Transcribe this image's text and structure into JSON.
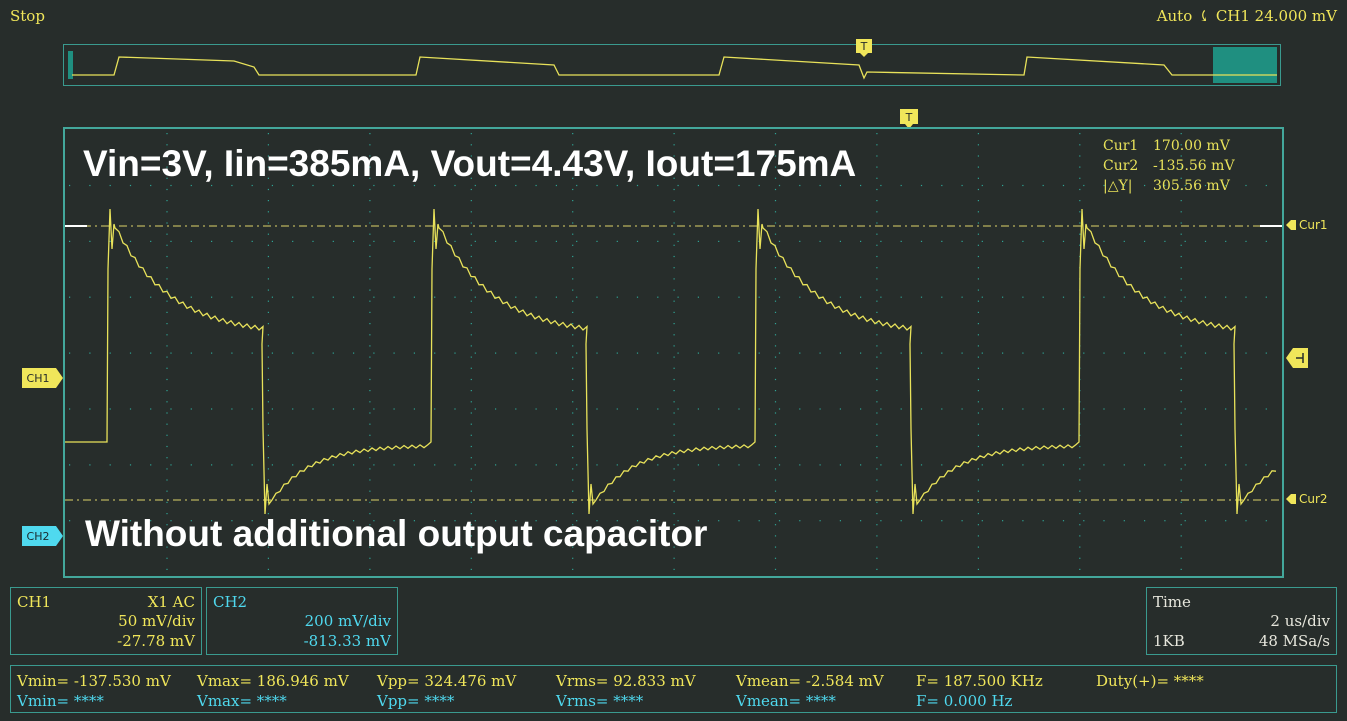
{
  "status": {
    "run_state": "Stop",
    "trigger_mode": "Auto",
    "trigger_source_level": "CH1  24.000 mV"
  },
  "overview": {
    "trigger_marker": "T"
  },
  "screen": {
    "trigger_marker": "T",
    "title_text": "Vin=3V, Iin=385mA, Vout=4.43V, Iout=175mA",
    "caption_text": "Without additional output capacitor",
    "ch1_marker": "CH1",
    "ch2_marker": "CH2",
    "cursor1_tag": "Cur1",
    "cursor2_tag": "Cur2",
    "cursor_readout": {
      "cur1_label": "Cur1",
      "cur1_value": "170.00 mV",
      "cur2_label": "Cur2",
      "cur2_value": "-135.56 mV",
      "delta_label": "|△Y|",
      "delta_value": "305.56 mV"
    }
  },
  "ch1_panel": {
    "name": "CH1",
    "probe_coupling": "X1  AC",
    "scale": "50 mV/div",
    "offset": "-27.78 mV"
  },
  "ch2_panel": {
    "name": "CH2",
    "scale": "200 mV/div",
    "offset": "-813.33 mV"
  },
  "time_panel": {
    "name": "Time",
    "scale": "2 us/div",
    "memory_depth": "1KB",
    "sample_rate": "48 MSa/s"
  },
  "measurements": {
    "ch1": [
      "Vmin= -137.530 mV",
      "Vmax= 186.946 mV",
      "Vpp= 324.476 mV",
      "Vrms= 92.833 mV",
      "Vmean= -2.584 mV",
      "F= 187.500 KHz",
      "Duty(+)= ****"
    ],
    "ch2": [
      "Vmin= ****",
      "Vmax= ****",
      "Vpp= ****",
      "Vrms= ****",
      "Vmean= ****",
      "F= 0.000 Hz"
    ]
  },
  "colors": {
    "ch1": "#f0e65a",
    "ch2": "#4fd9ef",
    "grid_border": "#43a79b",
    "background": "#272d2b"
  }
}
